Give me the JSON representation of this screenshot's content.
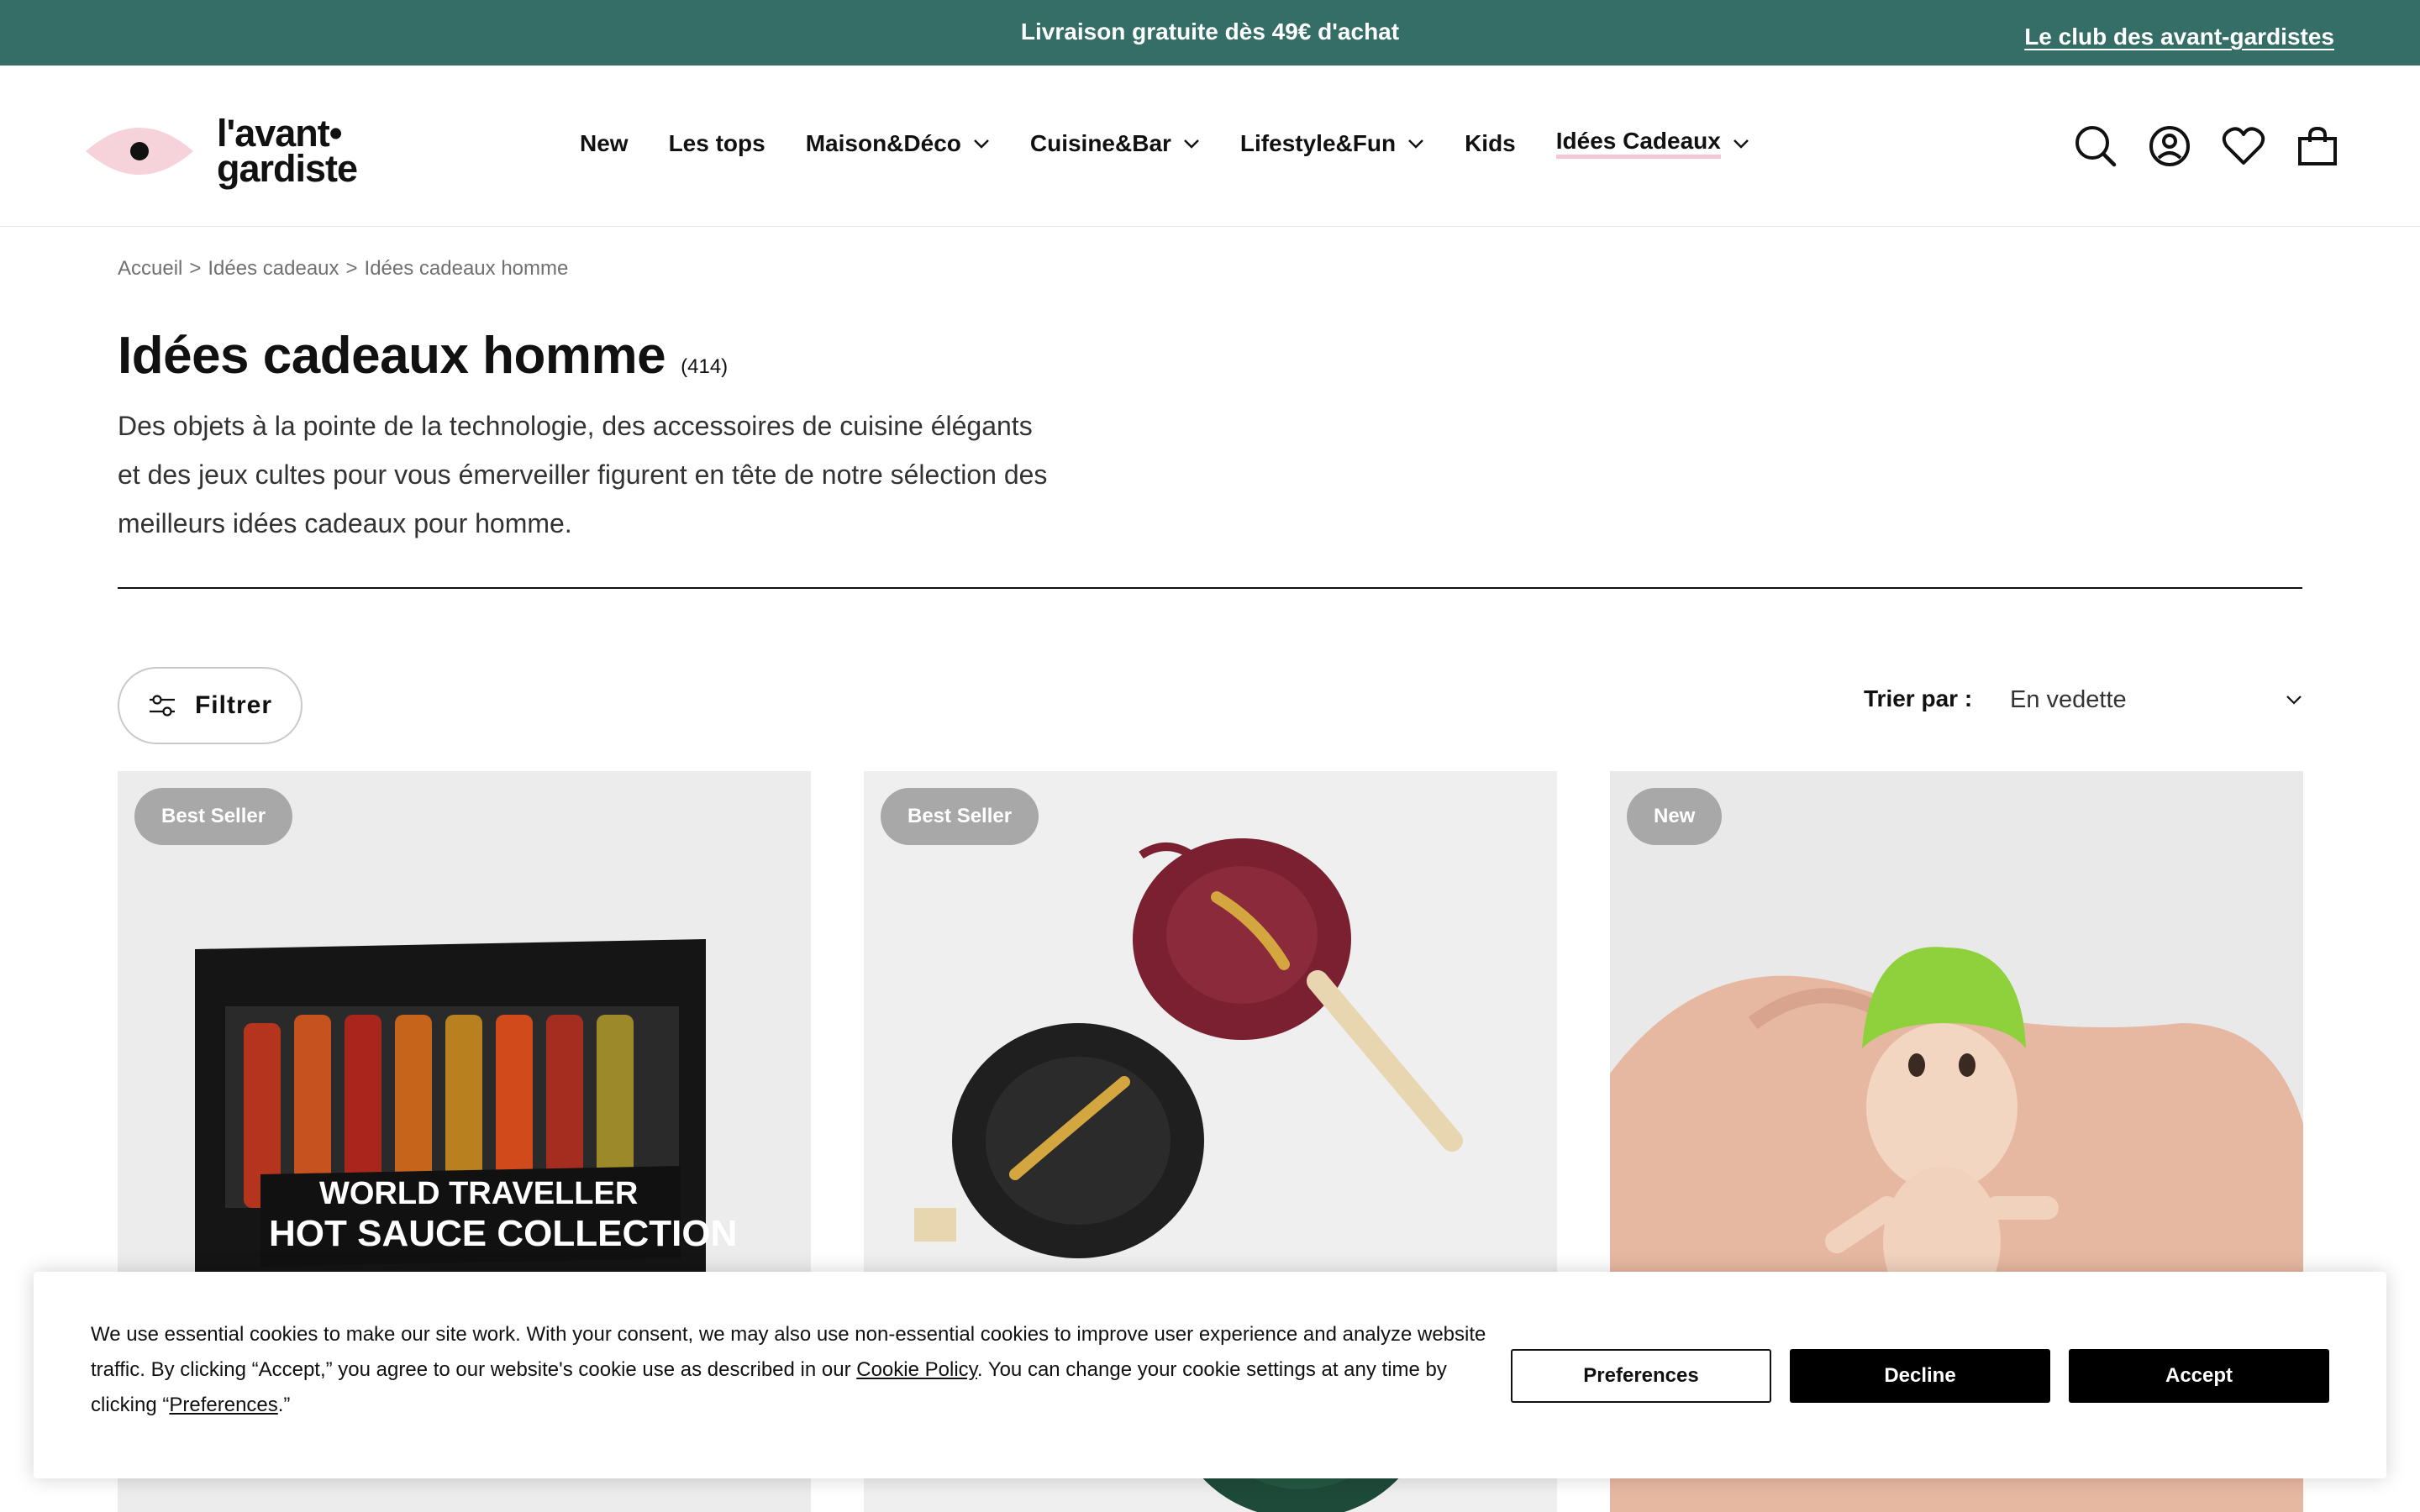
{
  "announcement": {
    "message": "Livraison gratuite dès 49€ d'achat",
    "club_link": "Le club des avant-gardistes",
    "bg_color": "#356e67"
  },
  "logo": {
    "line1": "l'avant•",
    "line2": "gardiste"
  },
  "nav": {
    "items": [
      {
        "label": "New",
        "dropdown": false
      },
      {
        "label": "Les tops",
        "dropdown": false
      },
      {
        "label": "Maison&Déco",
        "dropdown": true
      },
      {
        "label": "Cuisine&Bar",
        "dropdown": true
      },
      {
        "label": "Lifestyle&Fun",
        "dropdown": true
      },
      {
        "label": "Kids",
        "dropdown": false
      },
      {
        "label": "Idées Cadeaux",
        "dropdown": true,
        "active": true
      }
    ]
  },
  "header_icons": [
    "search-icon",
    "account-icon",
    "heart-icon",
    "cart-icon"
  ],
  "breadcrumb": [
    "Accueil",
    "Idées cadeaux",
    "Idées cadeaux homme"
  ],
  "page": {
    "title": "Idées cadeaux homme",
    "count": "(414)",
    "description": "Des objets à la pointe de la technologie, des accessoires de cuisine élégants et des jeux cultes pour vous émerveiller figurent en tête de notre sélection des meilleurs idées cadeaux pour homme."
  },
  "toolbar": {
    "filter_label": "Filtrer",
    "sort_label": "Trier par :",
    "sort_value": "En vedette"
  },
  "products": [
    {
      "badge": "Best Seller",
      "image_text_line1": "WORLD TRAVELLER",
      "image_text_line2": "HOT SAUCE COLLECTION"
    },
    {
      "badge": "Best Seller"
    },
    {
      "badge": "New"
    }
  ],
  "cookie": {
    "text_part1": "We use essential cookies to make our site work. With your consent, we may also use non-essential cookies to improve user experience and analyze website traffic. By clicking “Accept,” you agree to our website's cookie use as described in our ",
    "policy_link": "Cookie Policy",
    "text_part2": ". You can change your cookie settings at any time by clicking “",
    "preferences_link": "Preferences",
    "text_part3": ".”",
    "preferences_button": "Preferences",
    "decline_button": "Decline",
    "accept_button": "Accept"
  }
}
